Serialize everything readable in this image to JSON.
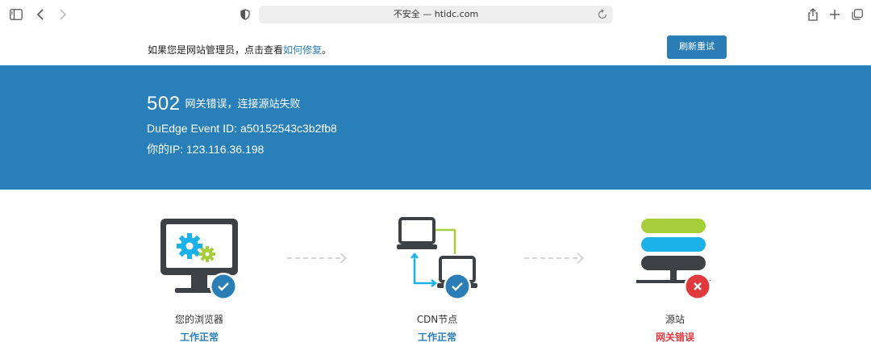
{
  "browser": {
    "url_text": "不安全 — htidc.com"
  },
  "notice": {
    "prefix": "如果您是网站管理员，点击查看",
    "link": "如何修复",
    "suffix": "。",
    "refresh_button": "刷新重试"
  },
  "error": {
    "code": "502",
    "message": "网关错误，连接源站失败",
    "event_id": "DuEdge Event ID: a50152543c3b2fb8",
    "ip": "你的IP: 123.116.36.198"
  },
  "nodes": [
    {
      "label": "您的浏览器",
      "status": "工作正常",
      "state": "ok"
    },
    {
      "label": "CDN节点",
      "status": "工作正常",
      "state": "ok"
    },
    {
      "label": "源站",
      "status": "网关错误",
      "state": "error"
    }
  ],
  "colors": {
    "accent": "#2980b9",
    "ok": "#2a7db5",
    "error": "#e0393e",
    "server_green": "#a6ce39",
    "server_blue": "#1ab2e8",
    "server_dark": "#3d4044"
  }
}
